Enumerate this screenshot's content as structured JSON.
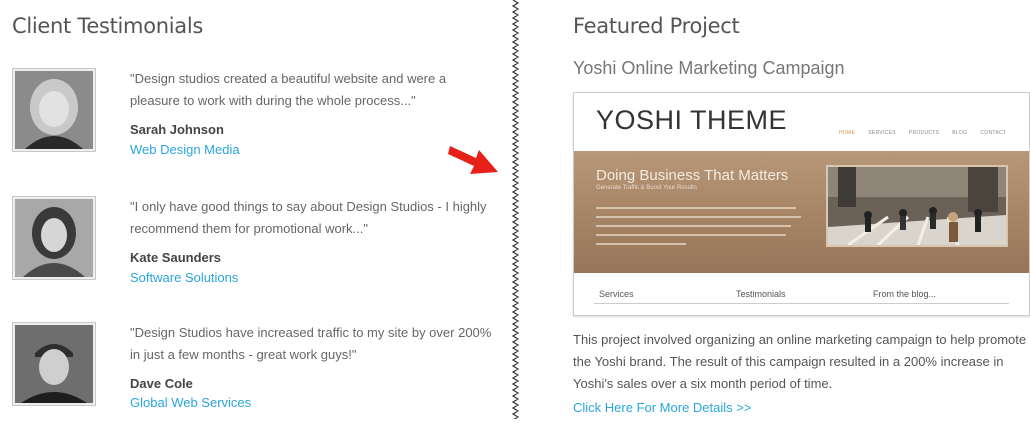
{
  "testimonials_section": {
    "title": "Client Testimonials",
    "items": [
      {
        "quote": "\"Design studios created a beautiful website and were a pleasure to work with during the whole process...\"",
        "author": "Sarah Johnson",
        "company": "Web Design Media"
      },
      {
        "quote": "\"I only have good things to say about Design Studios - I highly recommend them for promotional work...\"",
        "author": "Kate Saunders",
        "company": "Software Solutions"
      },
      {
        "quote": "\"Design Studios have increased traffic to my site by over 200% in just a few months - great work guys!\"",
        "author": "Dave Cole",
        "company": "Global Web Services"
      }
    ]
  },
  "featured_section": {
    "title": "Featured Project",
    "project_title": "Yoshi Online Marketing Campaign",
    "screenshot": {
      "logo": "YOSHI THEME",
      "nav": [
        "HOME",
        "SERVICES",
        "PRODUCTS",
        "BLOG",
        "CONTACT"
      ],
      "headline": "Doing Business That Matters",
      "tagline": "Generate Traffic & Boost Your Results",
      "columns": [
        "Services",
        "Testimonials",
        "From the blog..."
      ]
    },
    "description": "This project involved organizing an online marketing campaign to help promote the Yoshi brand. The result of this campaign resulted in a 200% increase in Yoshi's sales over a six month period of time.",
    "details_link": "Click Here For More Details >>"
  },
  "colors": {
    "link": "#2aa6de",
    "arrow": "#e8201a"
  }
}
